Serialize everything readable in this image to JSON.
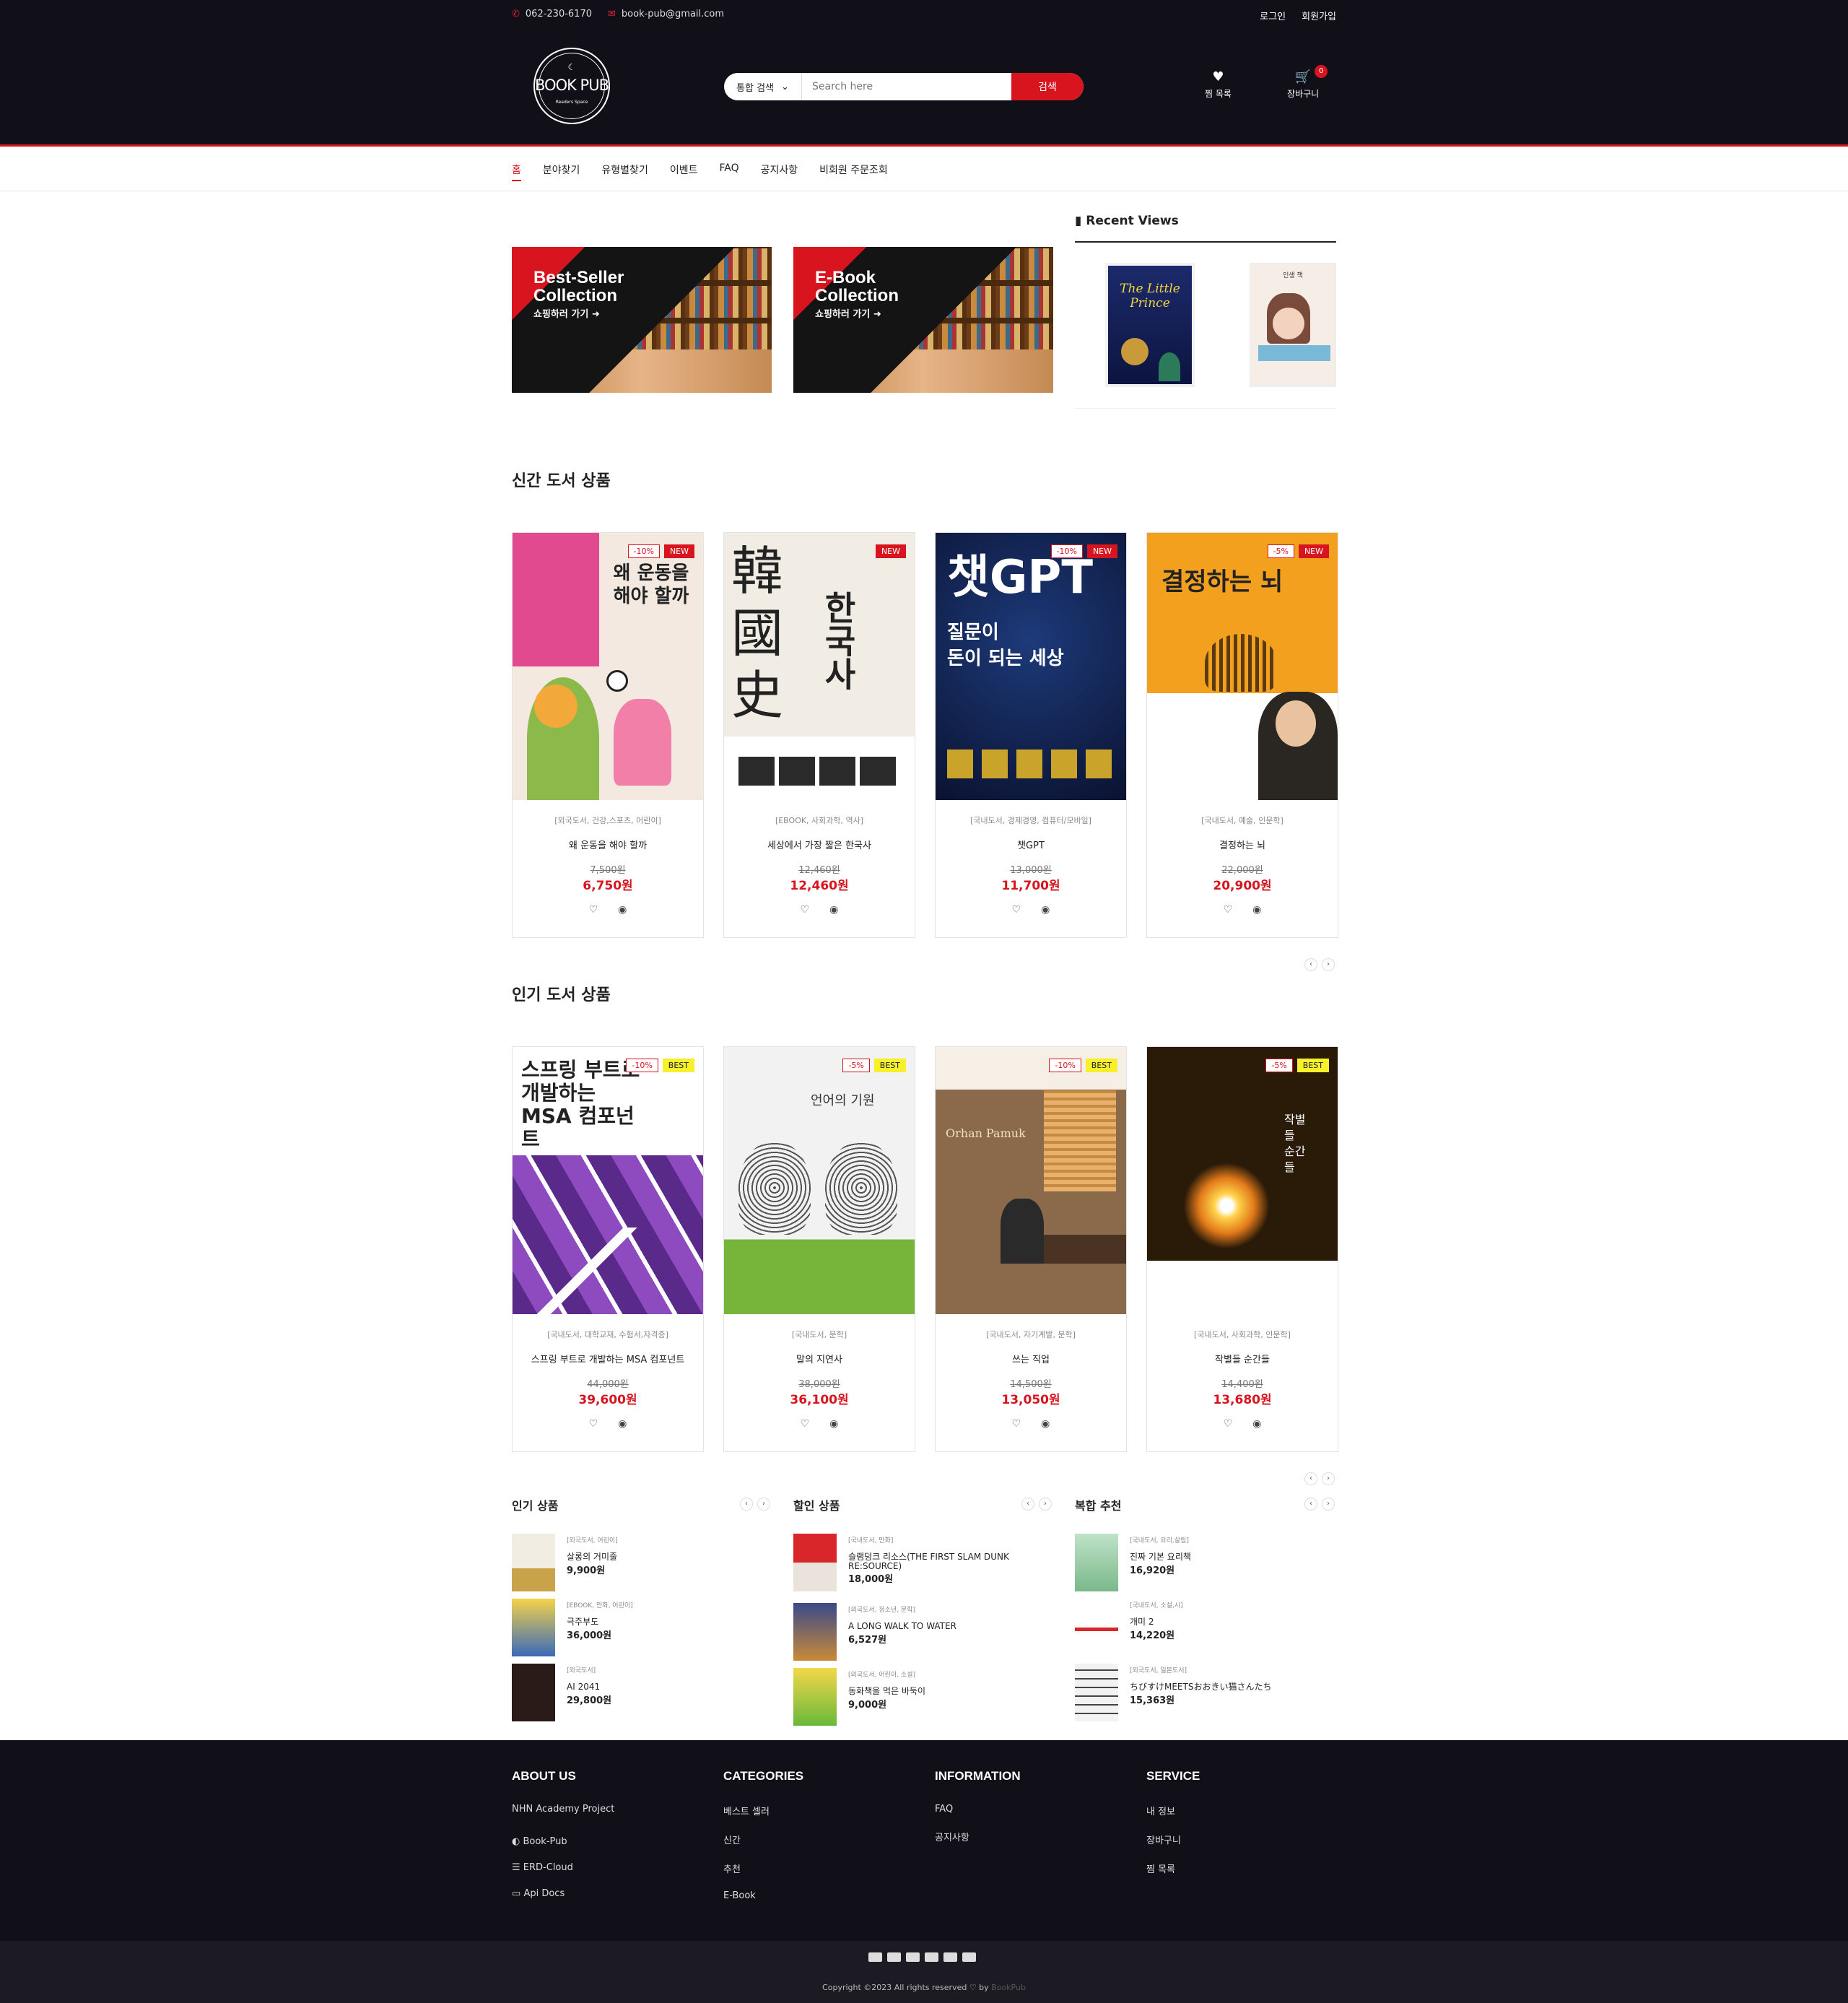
{
  "header": {
    "phone": "062-230-6170",
    "email": "book-pub@gmail.com",
    "login": "로그인",
    "signup": "회원가입",
    "logo_title": "BOOK PUB",
    "logo_sub": "Readers Space",
    "search_scope": "통합 검색",
    "search_placeholder": "Search here",
    "search_button": "검색",
    "wishlist": "찜 목록",
    "cart": "장바구니",
    "cart_count": "0"
  },
  "nav": [
    "홈",
    "분야찾기",
    "유형별찾기",
    "이벤트",
    "FAQ",
    "공지사항",
    "비회원 주문조회"
  ],
  "banners": [
    {
      "title1": "Best-Seller",
      "title2": "Collection",
      "go": "쇼핑하러 가기"
    },
    {
      "title1": "E-Book",
      "title2": "Collection",
      "go": "쇼핑하러 가기"
    }
  ],
  "recent": {
    "title": "Recent Views",
    "covers": [
      "The Little Prince",
      "인생 책"
    ]
  },
  "new_books": {
    "title": "신간 도서 상품",
    "items": [
      {
        "cat": "[외국도서, 건강,스포츠, 어린이]",
        "name": "왜 운동을 해야 할까",
        "orig": "7,500원",
        "price": "6,750원",
        "disc": "-10%",
        "tag": "NEW",
        "cover_text": "왜 운동을 해야 할까"
      },
      {
        "cat": "[EBOOK, 사회과학, 역사]",
        "name": "세상에서 가장 짧은 한국사",
        "orig": "12,460원",
        "price": "12,460원",
        "disc": "",
        "tag": "NEW",
        "cover_text": "한국사"
      },
      {
        "cat": "[국내도서, 경제경영, 컴퓨터/모바일]",
        "name": "챗GPT",
        "orig": "13,000원",
        "price": "11,700원",
        "disc": "-10%",
        "tag": "NEW",
        "cover_text": "챗GPT"
      },
      {
        "cat": "[국내도서, 예술, 인문학]",
        "name": "결정하는 뇌",
        "orig": "22,000원",
        "price": "20,900원",
        "disc": "-5%",
        "tag": "NEW",
        "cover_text": "결정하는 뇌"
      }
    ]
  },
  "popular_books": {
    "title": "인기 도서 상품",
    "items": [
      {
        "cat": "[국내도서, 대학교재, 수험서,자격증]",
        "name": "스프링 부트로 개발하는 MSA 컴포넌트",
        "orig": "44,000원",
        "price": "39,600원",
        "disc": "-10%",
        "tag": "BEST",
        "cover_text": "스프링 부트로 개발하는 MSA 컴포넌트"
      },
      {
        "cat": "[국내도서, 문학]",
        "name": "말의 지연사",
        "orig": "38,000원",
        "price": "36,100원",
        "disc": "-5%",
        "tag": "BEST",
        "cover_text": "언어의 기원"
      },
      {
        "cat": "[국내도서, 자기계발, 문학]",
        "name": "쓰는 직업",
        "orig": "14,500원",
        "price": "13,050원",
        "disc": "-10%",
        "tag": "BEST",
        "cover_text": "Orhan Pamuk"
      },
      {
        "cat": "[국내도서, 사회과학, 인문학]",
        "name": "작별들 순간들",
        "orig": "14,400원",
        "price": "13,680원",
        "disc": "-5%",
        "tag": "BEST",
        "cover_text": "작별들 순간들"
      }
    ]
  },
  "mini_lists": [
    {
      "title": "인기 상품",
      "items": [
        {
          "cat": "[외국도서, 어린이]",
          "name": "살롱의 거미줄",
          "price": "9,900원"
        },
        {
          "cat": "[EBOOK, 만화, 어린이]",
          "name": "극주부도",
          "price": "36,000원"
        },
        {
          "cat": "[외국도서]",
          "name": "AI 2041",
          "price": "29,800원"
        }
      ]
    },
    {
      "title": "할인 상품",
      "items": [
        {
          "cat": "[국내도서, 만화]",
          "name": "슬램덩크 리소스(THE FIRST SLAM DUNK RE:SOURCE)",
          "price": "18,000원"
        },
        {
          "cat": "[외국도서, 청소년, 문학]",
          "name": "A LONG WALK TO WATER",
          "price": "6,527원"
        },
        {
          "cat": "[외국도서, 어린이, 소설]",
          "name": "동화책을 먹은 바둑이",
          "price": "9,000원"
        }
      ]
    },
    {
      "title": "복합 추천",
      "items": [
        {
          "cat": "[국내도서, 요리,살림]",
          "name": "진짜 기본 요리책",
          "price": "16,920원"
        },
        {
          "cat": "[국내도서, 소설,시]",
          "name": "개미 2",
          "price": "14,220원"
        },
        {
          "cat": "[외국도서, 일본도서]",
          "name": "ちびすけMEETSおおきい猫さんたち",
          "price": "15,363원"
        }
      ]
    }
  ],
  "footer": {
    "about": {
      "title": "ABOUT US",
      "lines": [
        "NHN Academy Project"
      ],
      "links": [
        "Book-Pub",
        "ERD-Cloud",
        "Api Docs"
      ]
    },
    "categories": {
      "title": "CATEGORIES",
      "links": [
        "베스트 셀러",
        "신간",
        "추천",
        "E-Book"
      ]
    },
    "information": {
      "title": "INFORMATION",
      "links": [
        "FAQ",
        "공지사항"
      ]
    },
    "service": {
      "title": "SERVICE",
      "links": [
        "내 정보",
        "장바구니",
        "찜 목록"
      ]
    },
    "copyright": "Copyright ©2023 All rights reserved ♡ by",
    "brand": "BookPub"
  },
  "colors": {
    "accent": "#d8151f",
    "dark": "#111019",
    "best": "#f7f02a"
  }
}
